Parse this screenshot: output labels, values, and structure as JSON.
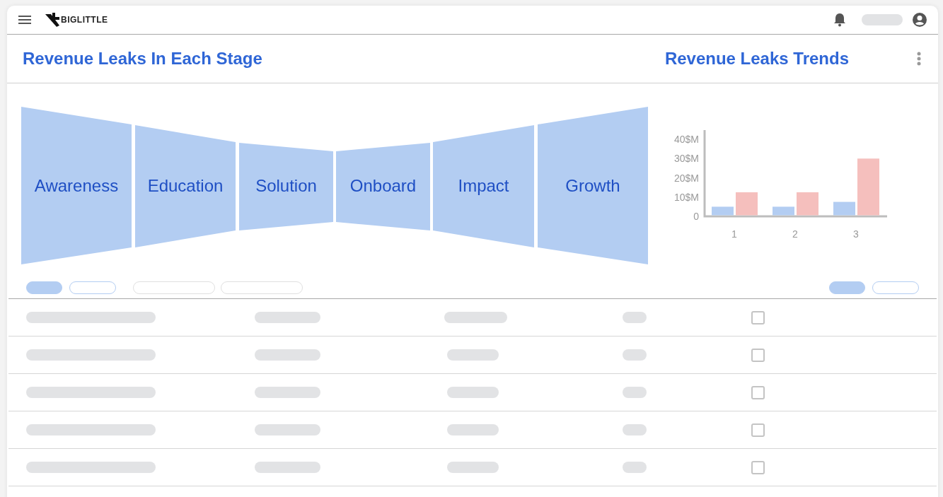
{
  "brand": {
    "name": "BIGLITTLE"
  },
  "panels": [
    {
      "title": "Revenue Leaks In Each Stage"
    },
    {
      "title": "Revenue Leaks Trends"
    }
  ],
  "stages": [
    {
      "label": "Awareness"
    },
    {
      "label": "Education"
    },
    {
      "label": "Solution"
    },
    {
      "label": "Onboard"
    },
    {
      "label": "Impact"
    },
    {
      "label": "Growth"
    }
  ],
  "chart_data": {
    "type": "bar",
    "categories": [
      "1",
      "2",
      "3"
    ],
    "series": [
      {
        "color": "#b3cdf2",
        "values": [
          5,
          5,
          7.5
        ]
      },
      {
        "color": "#f5bfbd",
        "values": [
          12.5,
          12.5,
          30
        ]
      }
    ],
    "ylim": [
      0,
      44.8
    ],
    "yticks": [
      {
        "value": 0,
        "label": "0"
      },
      {
        "value": 10,
        "label": "10$M"
      },
      {
        "value": 20,
        "label": "20$M"
      },
      {
        "value": 30,
        "label": "30$M"
      },
      {
        "value": 40,
        "label": "40$M"
      }
    ]
  },
  "filters_left": [
    {
      "selected": true
    },
    {
      "selected": false
    }
  ],
  "filters_right": [
    {
      "selected": true
    },
    {
      "selected": false
    }
  ],
  "rows": [
    {
      "checked": false
    },
    {
      "checked": false
    },
    {
      "checked": false
    },
    {
      "checked": false
    },
    {
      "checked": false
    }
  ]
}
